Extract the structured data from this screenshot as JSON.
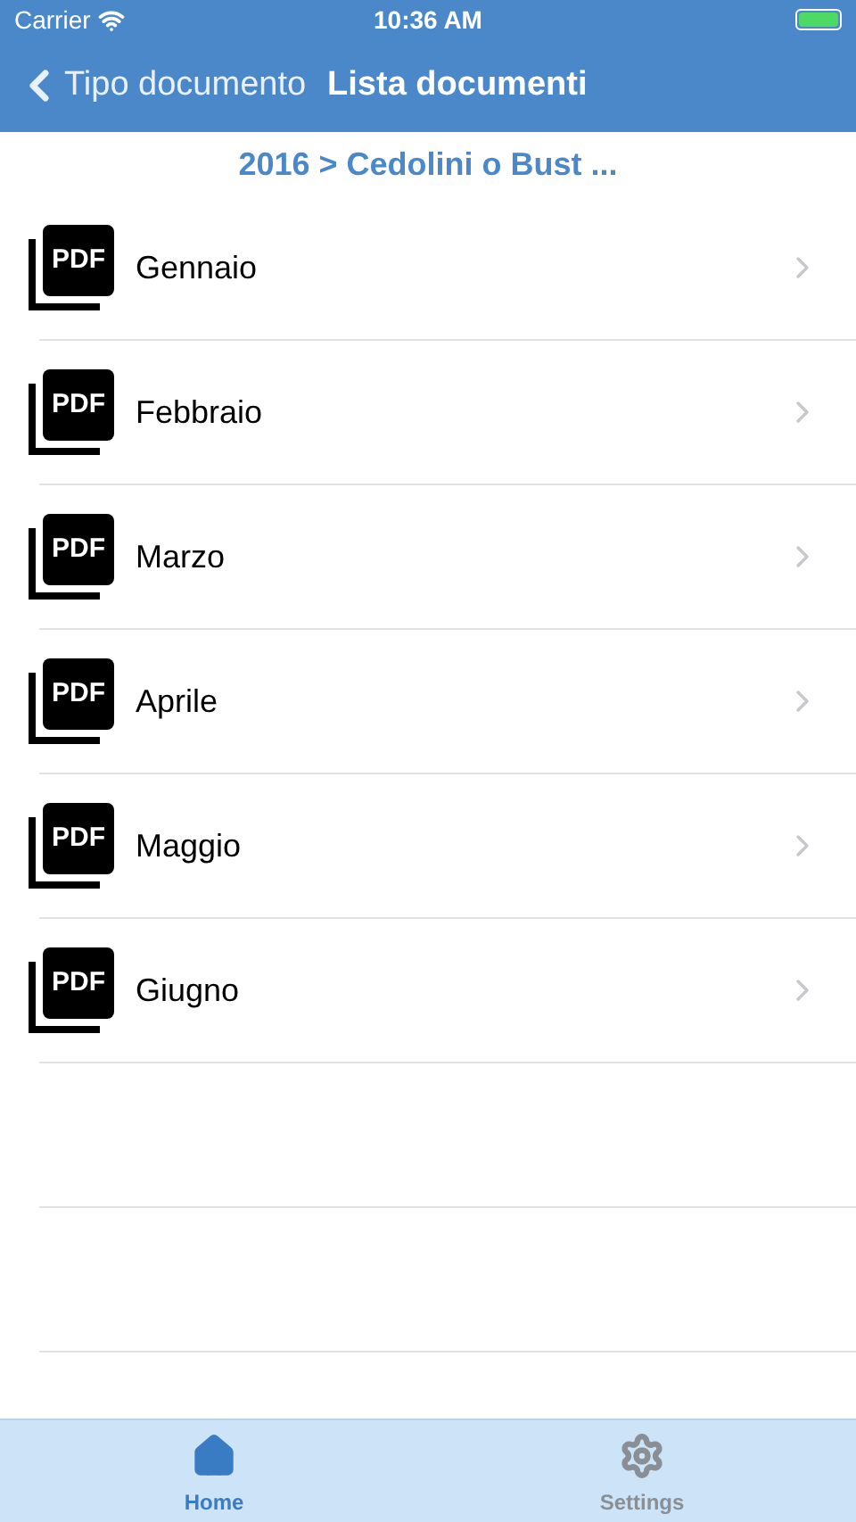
{
  "status_bar": {
    "carrier": "Carrier",
    "time": "10:36 AM"
  },
  "nav_bar": {
    "back_label": "Tipo documento",
    "title": "Lista documenti"
  },
  "breadcrumb": "2016 > Cedolini o Bust ...",
  "documents": [
    {
      "name": "Gennaio",
      "icon_label": "PDF"
    },
    {
      "name": "Febbraio",
      "icon_label": "PDF"
    },
    {
      "name": "Marzo",
      "icon_label": "PDF"
    },
    {
      "name": "Aprile",
      "icon_label": "PDF"
    },
    {
      "name": "Maggio",
      "icon_label": "PDF"
    },
    {
      "name": "Giugno",
      "icon_label": "PDF"
    }
  ],
  "tab_bar": [
    {
      "kind": "home",
      "label": "Home",
      "selected": true
    },
    {
      "kind": "settings",
      "label": "Settings",
      "selected": false
    }
  ]
}
